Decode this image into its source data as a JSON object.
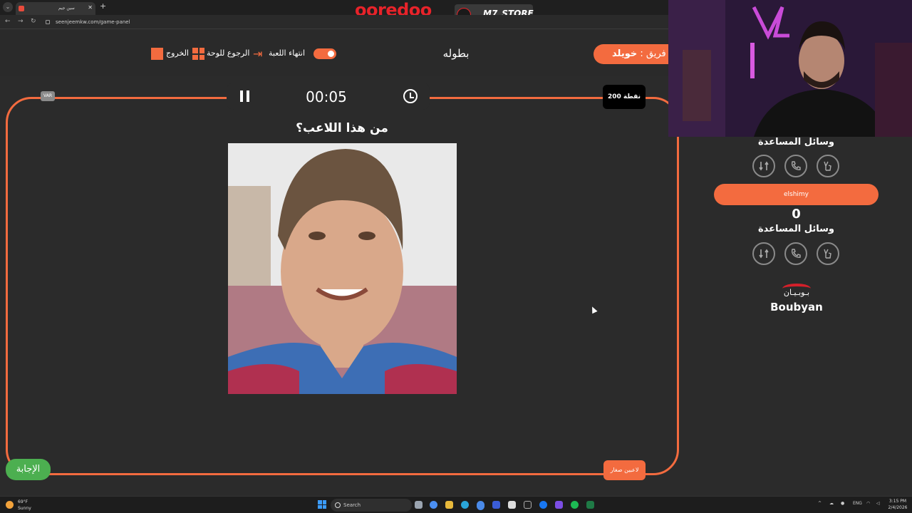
{
  "browser": {
    "tab_title": "سين جيم",
    "url": "seenjeemkw.com/game-panel"
  },
  "sponsors": {
    "ooredoo": "ooredoo",
    "m7_store": "M7_STORE",
    "boubyan_ar": "بـوبـيـان",
    "boubyan_en": "Boubyan"
  },
  "header": {
    "exit_label": "الخروج",
    "back_label": "الرجوع للوحة",
    "end_game_label": "انتهاء اللعبة",
    "title": "بطوله",
    "team_prefix": "فريق :",
    "team_name": "خويلد"
  },
  "game": {
    "var_label": "VAR",
    "timer": "00:05",
    "points": "200 نقطة",
    "question": "من هذا اللاعب؟",
    "answer_label": "الإجابة",
    "category": "لاعبين صغار"
  },
  "sidebar": {
    "aids_title_1": "وسائل المساعدة",
    "player_name": "elshimy",
    "score": "0",
    "aids_title_2": "وسائل المساعدة"
  },
  "taskbar": {
    "temperature": "69°F",
    "condition": "Sunny",
    "search_placeholder": "Search",
    "language": "ENG",
    "time": "3:15 PM",
    "date": "2/4/2026"
  },
  "colors": {
    "accent": "#f36b3f",
    "answer_green": "#4caf50",
    "background": "#2b2b2b"
  }
}
